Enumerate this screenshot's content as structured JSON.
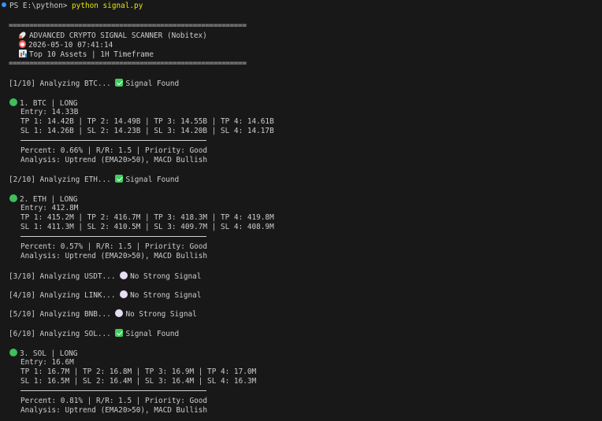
{
  "prompt": {
    "text": "PS E:\\python> ",
    "command": "python signal.py"
  },
  "banner": {
    "rule": "==========================================================================",
    "title": "ADVANCED CRYPTO SIGNAL SCANNER (Nobitex)",
    "datetime": "2026-05-10 07:41:14",
    "scope": "Top 10 Assets | 1H Timeframe"
  },
  "status_lines": [
    {
      "text": "[1/10] Analyzing BTC... ",
      "result": "Signal Found",
      "found": true
    },
    {
      "text": "[2/10] Analyzing ETH... ",
      "result": "Signal Found",
      "found": true
    },
    {
      "text": "[3/10] Analyzing USDT... ",
      "result": "No Strong Signal",
      "found": false
    },
    {
      "text": "[4/10] Analyzing LINK... ",
      "result": "No Strong Signal",
      "found": false
    },
    {
      "text": "[5/10] Analyzing BNB... ",
      "result": "No Strong Signal",
      "found": false
    },
    {
      "text": "[6/10] Analyzing SOL... ",
      "result": "Signal Found",
      "found": true
    }
  ],
  "signals": [
    {
      "header": "1. BTC | LONG",
      "entry": "Entry: 14.33B",
      "tp": "TP 1: 14.42B | TP 2: 14.49B | TP 3: 14.55B | TP 4: 14.61B",
      "sl": "SL 1: 14.26B | SL 2: 14.23B | SL 3: 14.20B | SL 4: 14.17B",
      "stats": "Percent: 0.66% | R/R: 1.5 | Priority: Good",
      "analysis": "Analysis: Uptrend (EMA20>50), MACD Bullish"
    },
    {
      "header": "2. ETH | LONG",
      "entry": "Entry: 412.8M",
      "tp": "TP 1: 415.2M | TP 2: 416.7M | TP 3: 418.3M | TP 4: 419.8M",
      "sl": "SL 1: 411.3M | SL 2: 410.5M | SL 3: 409.7M | SL 4: 408.9M",
      "stats": "Percent: 0.57% | R/R: 1.5 | Priority: Good",
      "analysis": "Analysis: Uptrend (EMA20>50), MACD Bullish"
    },
    {
      "header": "3. SOL | LONG",
      "entry": "Entry: 16.6M",
      "tp": "TP 1: 16.7M | TP 2: 16.8M | TP 3: 16.9M | TP 4: 17.0M",
      "sl": "SL 1: 16.5M | SL 2: 16.4M | SL 3: 16.4M | SL 4: 16.3M",
      "stats": "Percent: 0.81% | R/R: 1.5 | Priority: Good",
      "analysis": "Analysis: Uptrend (EMA20>50), MACD Bullish"
    }
  ],
  "colors": {
    "background": "#181818",
    "text": "#cccccc",
    "command": "#e5e510",
    "prompt_dot": "#3794ff"
  }
}
